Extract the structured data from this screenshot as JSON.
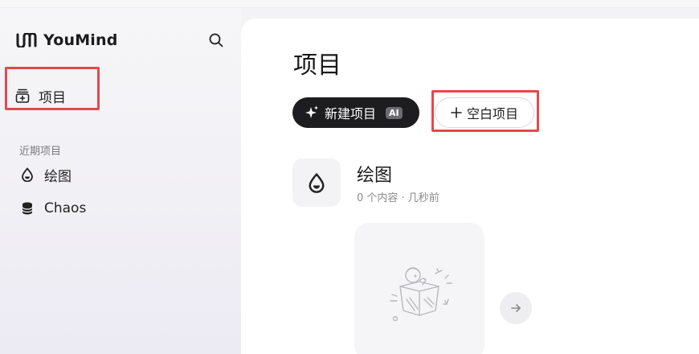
{
  "app": {
    "brand_name": "YouMind",
    "brand_logo_icon": "youmind-logo-icon",
    "accent_dark": "#1d1d1f",
    "highlight_red": "#e5484d"
  },
  "sidebar": {
    "search_icon": "search-icon",
    "nav": [
      {
        "label": "项目",
        "icon": "projects-icon"
      }
    ],
    "recent_label": "近期项目",
    "recent": [
      {
        "label": "绘图",
        "icon": "drop-icon"
      },
      {
        "label": "Chaos",
        "icon": "database-icon"
      }
    ]
  },
  "main": {
    "title": "项目",
    "new_button": {
      "label": "新建项目",
      "badge": "AI",
      "icon": "sparkle-icon"
    },
    "blank_button": {
      "label": "空白项目",
      "icon": "plus-icon"
    },
    "project": {
      "name": "绘图",
      "meta": "0 个内容 · 几秒前",
      "icon": "drop-icon"
    },
    "empty_state_icon": "empty-box-illustration",
    "next_icon": "arrow-right-icon"
  }
}
